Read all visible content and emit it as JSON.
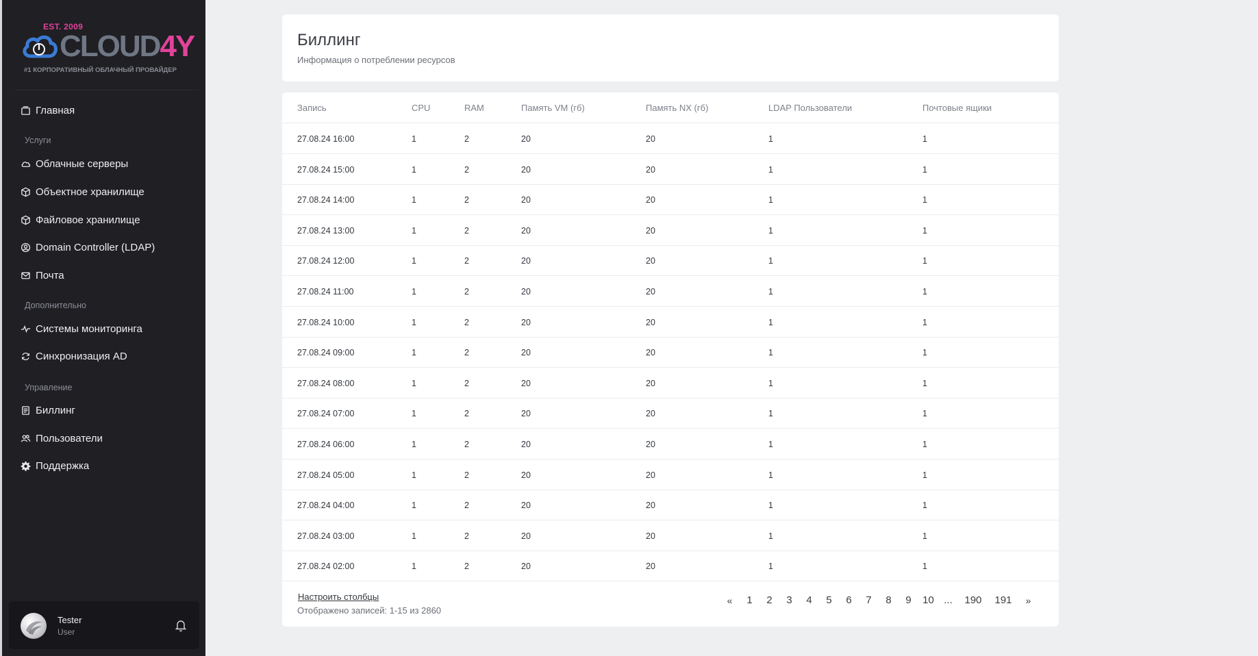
{
  "logo": {
    "est": "EST. 2009",
    "word_a": "CLOUD",
    "word_b": "4Y",
    "tagline": "#1 КОРПОРАТИВНЫЙ ОБЛАЧНЫЙ ПРОВАЙДЕР",
    "accent": "#e0439a",
    "cloud_color": "#3a7bd5"
  },
  "sidebar": {
    "home": "Главная",
    "section_services": "Услуги",
    "services": [
      "Облачные серверы",
      "Объектное хранилище",
      "Файловое хранилище",
      "Domain Controller (LDAP)",
      "Почта"
    ],
    "section_extra": "Дополнительно",
    "extra": [
      "Системы мониторинга",
      "Синхронизация AD"
    ],
    "section_manage": "Управление",
    "manage": [
      "Биллинг",
      "Пользователи",
      "Поддержка"
    ]
  },
  "user": {
    "name": "Tester",
    "role": "User"
  },
  "header": {
    "title": "Биллинг",
    "subtitle": "Информация о потреблении ресурсов"
  },
  "table": {
    "columns": [
      "Запись",
      "CPU",
      "RAM",
      "Память VM (гб)",
      "Память NX (гб)",
      "LDAP Пользователи",
      "Почтовые ящики"
    ],
    "rows": [
      [
        "27.08.24 16:00",
        "1",
        "2",
        "20",
        "20",
        "1",
        "1"
      ],
      [
        "27.08.24 15:00",
        "1",
        "2",
        "20",
        "20",
        "1",
        "1"
      ],
      [
        "27.08.24 14:00",
        "1",
        "2",
        "20",
        "20",
        "1",
        "1"
      ],
      [
        "27.08.24 13:00",
        "1",
        "2",
        "20",
        "20",
        "1",
        "1"
      ],
      [
        "27.08.24 12:00",
        "1",
        "2",
        "20",
        "20",
        "1",
        "1"
      ],
      [
        "27.08.24 11:00",
        "1",
        "2",
        "20",
        "20",
        "1",
        "1"
      ],
      [
        "27.08.24 10:00",
        "1",
        "2",
        "20",
        "20",
        "1",
        "1"
      ],
      [
        "27.08.24 09:00",
        "1",
        "2",
        "20",
        "20",
        "1",
        "1"
      ],
      [
        "27.08.24 08:00",
        "1",
        "2",
        "20",
        "20",
        "1",
        "1"
      ],
      [
        "27.08.24 07:00",
        "1",
        "2",
        "20",
        "20",
        "1",
        "1"
      ],
      [
        "27.08.24 06:00",
        "1",
        "2",
        "20",
        "20",
        "1",
        "1"
      ],
      [
        "27.08.24 05:00",
        "1",
        "2",
        "20",
        "20",
        "1",
        "1"
      ],
      [
        "27.08.24 04:00",
        "1",
        "2",
        "20",
        "20",
        "1",
        "1"
      ],
      [
        "27.08.24 03:00",
        "1",
        "2",
        "20",
        "20",
        "1",
        "1"
      ],
      [
        "27.08.24 02:00",
        "1",
        "2",
        "20",
        "20",
        "1",
        "1"
      ]
    ],
    "configure_columns": "Настроить столбцы",
    "shown_records": "Отображено записей: 1-15 из 2860"
  },
  "pagination": [
    "«",
    "1",
    "2",
    "3",
    "4",
    "5",
    "6",
    "7",
    "8",
    "9",
    "10",
    "...",
    "190",
    "191",
    "»"
  ]
}
